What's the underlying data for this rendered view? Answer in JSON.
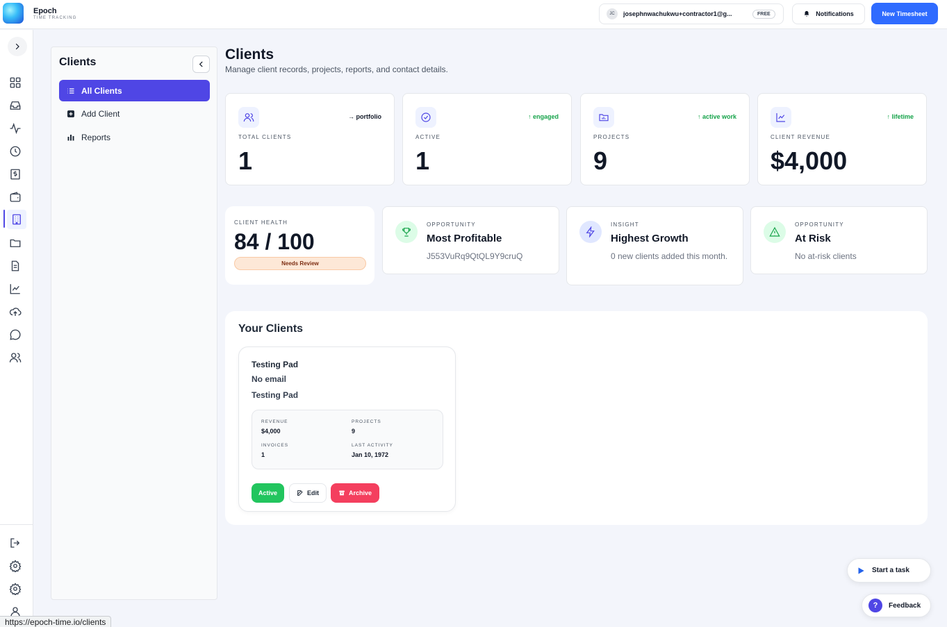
{
  "app": {
    "name": "Epoch",
    "subtitle": "TIME TRACKING"
  },
  "topbar": {
    "avatar_initials": "JC",
    "user_email": "josephnwachukwu+contractor1@g...",
    "plan_badge": "FREE",
    "notifications_label": "Notifications",
    "new_timesheet_label": "New Timesheet"
  },
  "rail": {
    "items": [
      "grid-icon",
      "inbox-icon",
      "activity-icon",
      "clock-icon",
      "invoice-icon",
      "wallet-icon",
      "building-icon",
      "folder-icon",
      "document-icon",
      "chart-icon",
      "cloud-upload-icon",
      "chat-icon",
      "team-icon"
    ],
    "bottom_items": [
      "logout-icon",
      "settings-icon",
      "settings-icon",
      "user-icon"
    ],
    "active_item": "building-icon"
  },
  "subnav": {
    "title": "Clients",
    "items": [
      {
        "label": "All Clients",
        "icon": "list-icon"
      },
      {
        "label": "Add Client",
        "icon": "plus-square-icon"
      },
      {
        "label": "Reports",
        "icon": "bar-chart-icon"
      }
    ]
  },
  "page": {
    "title": "Clients",
    "subtitle": "Manage client records, projects, reports, and contact details."
  },
  "stats": [
    {
      "label": "TOTAL CLIENTS",
      "value": "1",
      "tag": "→ portfolio",
      "tag_color": "#111827",
      "icon": "users-icon"
    },
    {
      "label": "ACTIVE",
      "value": "1",
      "tag": "↑ engaged",
      "tag_color": "#16a34a",
      "icon": "check-circle-icon"
    },
    {
      "label": "PROJECTS",
      "value": "9",
      "tag": "↑ active work",
      "tag_color": "#16a34a",
      "icon": "folder-chart-icon"
    },
    {
      "label": "CLIENT REVENUE",
      "value": "$4,000",
      "tag": "↑ lifetime",
      "tag_color": "#16a34a",
      "icon": "trend-icon"
    }
  ],
  "health": {
    "label": "CLIENT HEALTH",
    "value": "84 / 100",
    "badge": "Needs Review"
  },
  "insights": [
    {
      "kicker": "OPPORTUNITY",
      "title": "Most Profitable",
      "text": "J553VuRq9QtQL9Y9cruQ",
      "icon": "trophy-icon"
    },
    {
      "kicker": "INSIGHT",
      "title": "Highest Growth",
      "text": "0 new clients added this month.",
      "icon": "bolt-icon"
    },
    {
      "kicker": "OPPORTUNITY",
      "title": "At Risk",
      "text": "No at-risk clients",
      "icon": "warning-icon"
    }
  ],
  "clients_section": {
    "title": "Your Clients",
    "clients": [
      {
        "name": "Testing Pad",
        "email": "No email",
        "company": "Testing Pad",
        "revenue_label": "REVENUE",
        "revenue": "$4,000",
        "projects_label": "PROJECTS",
        "projects": "9",
        "invoices_label": "INVOICES",
        "invoices": "1",
        "last_activity_label": "LAST ACTIVITY",
        "last_activity": "Jan 10, 1972",
        "status_label": "Active",
        "edit_label": "Edit",
        "archive_label": "Archive"
      }
    ]
  },
  "floating": {
    "start_task": "Start a task",
    "feedback": "Feedback",
    "feedback_glyph": "?"
  },
  "status_url": "https://epoch-time.io/clients",
  "colors": {
    "accent": "#4f46e5",
    "primary_button": "#2f6bff",
    "success": "#22c55e",
    "danger": "#f43f5e"
  }
}
